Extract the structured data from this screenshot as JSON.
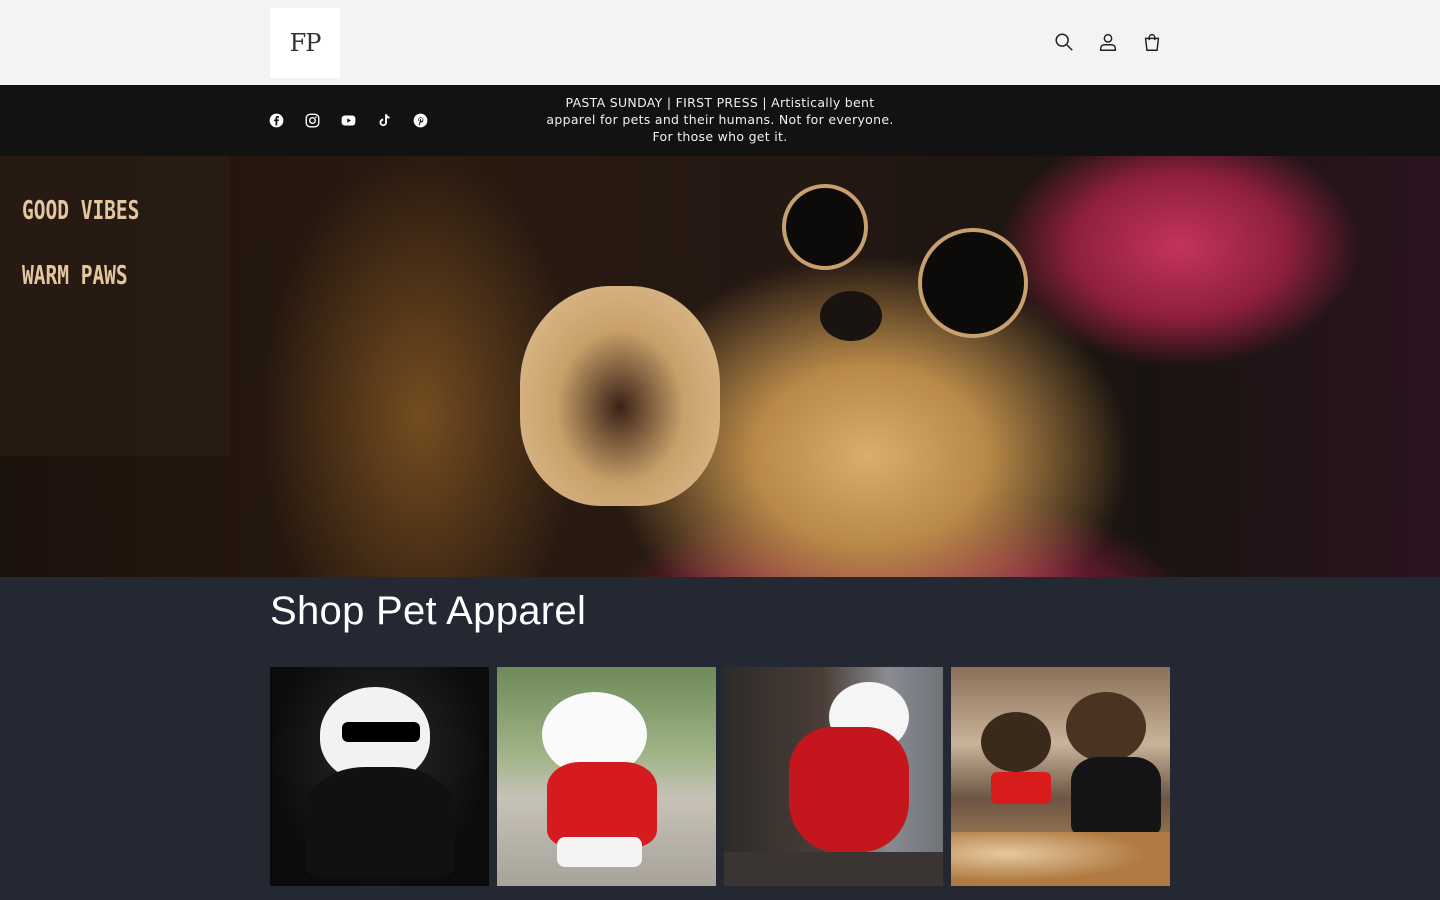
{
  "header": {
    "logo_text": "FP",
    "icons": [
      "search-icon",
      "account-icon",
      "cart-icon"
    ]
  },
  "announcement": {
    "text": "PASTA SUNDAY | FIRST PRESS | Artistically bent apparel for pets and their humans. Not for everyone. For those who get it.",
    "socials": [
      "facebook-icon",
      "instagram-icon",
      "youtube-icon",
      "tiktok-icon",
      "pinterest-icon"
    ]
  },
  "hero": {
    "sign_lines": [
      "GOOD VIBES",
      "WARM PAWS"
    ],
    "description": "dog in sunglasses and red beanie waving paw"
  },
  "main": {
    "section_title": "Shop Pet Apparel"
  },
  "colors": {
    "header_bg": "#f3f3f3",
    "announcement_bg": "#121212",
    "main_bg": "#242833"
  }
}
